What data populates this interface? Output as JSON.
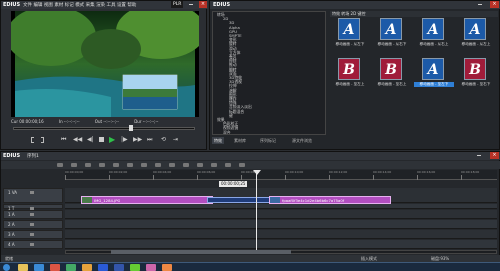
{
  "player": {
    "logo": "PLR",
    "logo_brand": "EDIUS",
    "menu": [
      "文件",
      "编辑",
      "视图",
      "素材",
      "标记",
      "模式",
      "采集",
      "渲染",
      "工具",
      "设置",
      "帮助"
    ],
    "mode_label": "PLR",
    "rec_label": "REC",
    "cue_label": "Cur 00:00:00;16",
    "in_label": "In --:--:--;--",
    "out_label": "Out --:--:--;--",
    "dur_label": "Dur --:--:--;--"
  },
  "bin": {
    "title": "EDIUS",
    "tree_items": [
      "转场",
      "2D",
      "3D",
      "Alpha",
      "GPU",
      "SMPTE",
      "变形",
      "旋转",
      "滑动",
      "立方体",
      "卷页",
      "擦除",
      "推动",
      "翻转",
      "双面",
      "3D特效",
      "3D透视",
      "拉伸",
      "溶解",
      "图形",
      "爆炸",
      "特殊",
      "音频淡入淡出",
      "标题混合",
      "键",
      "效果",
      "色彩校正",
      "视频滤镜",
      "混合",
      "键控"
    ],
    "selected_item": "键控",
    "tabs": [
      "特效",
      "素材库",
      "序列标记",
      "源文件浏览"
    ],
    "thumbnails": [
      {
        "letter": "A",
        "label": "移动画面 - 从左下"
      },
      {
        "letter": "A",
        "label": "移动画面 - 从右下"
      },
      {
        "letter": "A",
        "label": "移动画面 - 从右上"
      },
      {
        "letter": "A",
        "label": "移动画面 - 从左上"
      },
      {
        "letter": "B",
        "label": "移动画面 - 至左上"
      },
      {
        "letter": "B",
        "label": "移动画面 - 至右上"
      },
      {
        "letter": "A",
        "label": "移动画面 - 至左下"
      },
      {
        "letter": "B",
        "label": "移动画面 - 至右下"
      }
    ],
    "header_text": "特效 转场 2D 键控"
  },
  "timeline": {
    "title": "EDIUS",
    "sequence": "序列1",
    "timecode_popup": "00:00:00;25",
    "ruler_marks": [
      "00:00:00;00",
      "00:00:02;00",
      "00:00:04;00",
      "00:00:06;00",
      "00:00:08;00",
      "00:00:10;00",
      "00:00:12;00",
      "00:00:14;00",
      "00:00:16;00",
      "00:00:18;00"
    ],
    "tracks": [
      {
        "name": "1 VA",
        "type": "video"
      },
      {
        "name": "1 T",
        "type": "title"
      },
      {
        "name": "1 A",
        "type": "audio"
      },
      {
        "name": "2 A",
        "type": "audio"
      },
      {
        "name": "3 A",
        "type": "audio"
      },
      {
        "name": "4 A",
        "type": "audio"
      }
    ],
    "clip1_label": "IMG_1284.JPG",
    "clip2_label": "fpaaf0f3e4c1d2e4b6b6c7a75a0f",
    "status_left": "就绪",
    "status_mid": "插入模式",
    "status_right": "磁盘:93%"
  },
  "taskbar": {
    "apps": [
      "explorer",
      "ie",
      "media",
      "edius",
      "folder",
      "word",
      "qq",
      "player",
      "paint",
      "chrome"
    ]
  },
  "colors": {
    "accent": "#2f7fd6",
    "clip": "#b24ec0",
    "thumb_blue": "#1c5aa8",
    "thumb_red": "#a01c3a"
  }
}
